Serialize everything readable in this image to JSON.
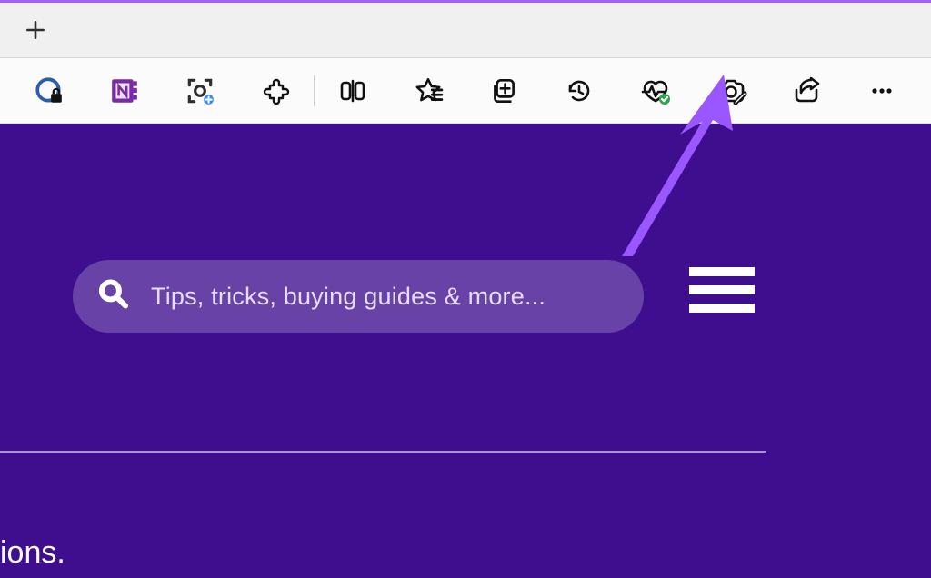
{
  "browser": {
    "new_tab_tooltip": "New tab",
    "toolbar_icons": [
      {
        "name": "password-manager-icon",
        "tooltip": "Password manager"
      },
      {
        "name": "onenote-icon",
        "tooltip": "OneNote clipper"
      },
      {
        "name": "capture-icon",
        "tooltip": "Screenshot tool"
      },
      {
        "name": "extensions-icon",
        "tooltip": "Extensions"
      },
      {
        "name": "split-screen-icon",
        "tooltip": "Split screen"
      },
      {
        "name": "favorites-icon",
        "tooltip": "Favorites"
      },
      {
        "name": "collections-icon",
        "tooltip": "Collections"
      },
      {
        "name": "history-icon",
        "tooltip": "History"
      },
      {
        "name": "performance-icon",
        "tooltip": "Browser essentials"
      },
      {
        "name": "web-capture-icon",
        "tooltip": "Web capture"
      },
      {
        "name": "share-icon",
        "tooltip": "Share"
      },
      {
        "name": "more-icon",
        "tooltip": "Settings and more"
      }
    ]
  },
  "page": {
    "search_placeholder": "Tips, tricks, buying guides & more...",
    "hamburger_label": "Menu",
    "footer_fragment": "ions."
  },
  "colors": {
    "page_bg": "#3f0e8f",
    "accent": "#9b57ff"
  },
  "annotation": {
    "highlights": "web-capture-icon"
  }
}
